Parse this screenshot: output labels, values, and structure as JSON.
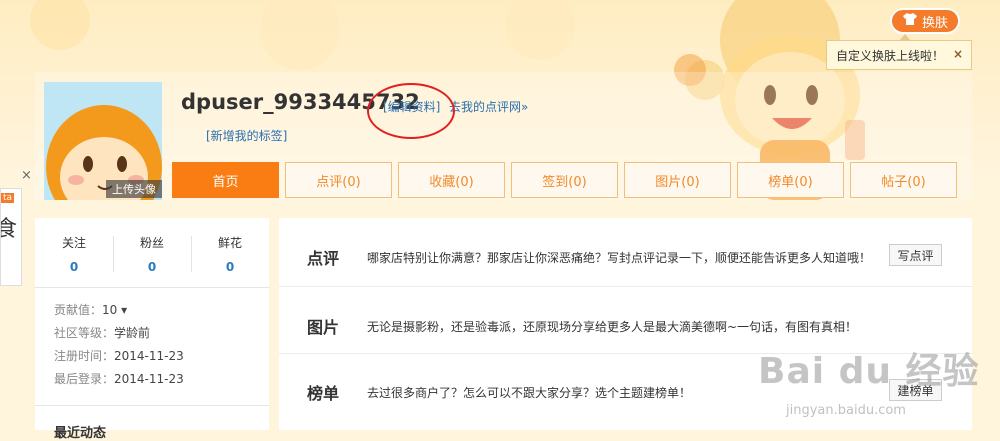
{
  "skin": {
    "label": "换肤",
    "tip": "自定义换肤上线啦！",
    "tip_close": "×"
  },
  "profile": {
    "username": "dpuser_9933445732",
    "edit_link": "[编辑资料]",
    "review_link": "去我的点评网»",
    "tag_link": "[新增我的标签]",
    "upload_avatar": "上传头像"
  },
  "tabs": [
    {
      "label": "首页",
      "active": true
    },
    {
      "label": "点评(0)"
    },
    {
      "label": "收藏(0)"
    },
    {
      "label": "签到(0)"
    },
    {
      "label": "图片(0)"
    },
    {
      "label": "榜单(0)"
    },
    {
      "label": "帖子(0)"
    }
  ],
  "side_ad": {
    "label": "ta",
    "close": "×",
    "glyph": "食"
  },
  "stats": [
    {
      "label": "关注",
      "value": "0"
    },
    {
      "label": "粉丝",
      "value": "0"
    },
    {
      "label": "鲜花",
      "value": "0"
    }
  ],
  "info": {
    "contribution_label": "贡献值：",
    "contribution_value": "10 ▾",
    "level_label": "社区等级：",
    "level_value": "学龄前",
    "register_label": "注册时间：",
    "register_value": "2014-11-23",
    "last_login_label": "最后登录：",
    "last_login_value": "2014-11-23"
  },
  "recent_title": "最近动态",
  "rows": [
    {
      "title": "点评",
      "text": "哪家店特别让你满意？那家店让你深恶痛绝？写封点评记录一下，顺便还能告诉更多人知道哦！",
      "button": "写点评"
    },
    {
      "title": "图片",
      "text": "无论是摄影粉，还是验毒派，还原现场分享给更多人是最大滴美德啊~一句话，有图有真相！",
      "button": ""
    },
    {
      "title": "榜单",
      "text": "去过很多商户了？怎么可以不跟大家分享？选个主题建榜单！",
      "button": "建榜单"
    }
  ],
  "watermark": {
    "main": "Bai du 经验",
    "sub": "jingyan.baidu.com"
  },
  "colors": {
    "accent": "#f97d12",
    "link": "#2a6fb0",
    "annotation": "#e02020"
  }
}
